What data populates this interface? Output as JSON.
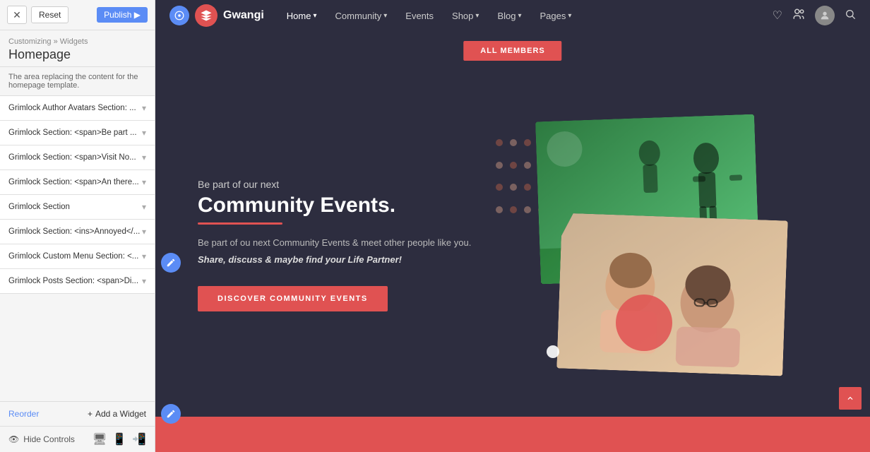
{
  "panel": {
    "close_label": "✕",
    "reset_label": "Reset",
    "publish_label": "Publish ▶",
    "breadcrumb": "Customizing » Widgets",
    "page_title": "Homepage",
    "info_text": "The area replacing the content for the homepage template.",
    "widgets": [
      {
        "label": "Grimlock Author Avatars Section: ..."
      },
      {
        "label": "Grimlock Section: <span>Be part ..."
      },
      {
        "label": "Grimlock Section: <span>Visit No..."
      },
      {
        "label": "Grimlock Section: <span>An there..."
      },
      {
        "label": "Grimlock Section"
      },
      {
        "label": "Grimlock Section: <ins>Annoyed</..."
      },
      {
        "label": "Grimlock Custom Menu Section: <..."
      },
      {
        "label": "Grimlock Posts Section: <span>Di..."
      }
    ],
    "reorder_label": "Reorder",
    "add_widget_label": "+ Add a Widget",
    "hide_controls_label": "Hide Controls"
  },
  "navbar": {
    "site_name": "Gwangi",
    "links": [
      {
        "label": "Home",
        "active": true,
        "has_dropdown": true
      },
      {
        "label": "Community",
        "active": false,
        "has_dropdown": true
      },
      {
        "label": "Events",
        "active": false,
        "has_dropdown": false
      },
      {
        "label": "Shop",
        "active": false,
        "has_dropdown": true
      },
      {
        "label": "Blog",
        "active": false,
        "has_dropdown": true
      },
      {
        "label": "Pages",
        "active": false,
        "has_dropdown": true
      }
    ]
  },
  "hero": {
    "all_members_label": "ALL MEMBERS",
    "subtitle": "Be part of our next",
    "title_line1": "Community Events.",
    "underline_color": "#e05252",
    "description": "Be part of ou next Community Events & meet other people like you.",
    "description_bold": "Share, discuss & maybe find your Life Partner!",
    "cta_label": "DISCOVER COMMUNITY EVENTS"
  },
  "colors": {
    "background": "#2d2d3f",
    "accent": "#e05252",
    "nav_bg": "#2a2a3a",
    "button_blue": "#5b8cf5"
  }
}
